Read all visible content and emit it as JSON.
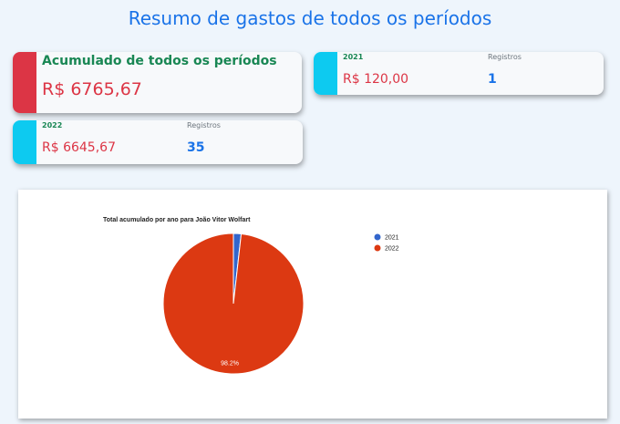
{
  "page": {
    "title": "Resumo de gastos de todos os períodos"
  },
  "summary": {
    "title": "Acumulado de todos os períodos",
    "value": "R$ 6765,67"
  },
  "years": [
    {
      "year": "2021",
      "value": "R$ 120,00",
      "records_label": "Registros",
      "records": "1"
    },
    {
      "year": "2022",
      "value": "R$ 6645,67",
      "records_label": "Registros",
      "records": "35"
    }
  ],
  "colors": {
    "title": "#1a73e8",
    "danger": "#dc3545",
    "success": "#198754",
    "info": "#0dcaf0",
    "slice_2021": "#3366cc",
    "slice_2022": "#dc3912"
  },
  "chart_data": {
    "type": "pie",
    "title": "Total acumulado por ano para João Vitor Wolfart",
    "categories": [
      "2021",
      "2022"
    ],
    "values": [
      120.0,
      6645.67
    ],
    "slice_labels": [
      "",
      "98.2%"
    ],
    "legend_position": "right"
  }
}
